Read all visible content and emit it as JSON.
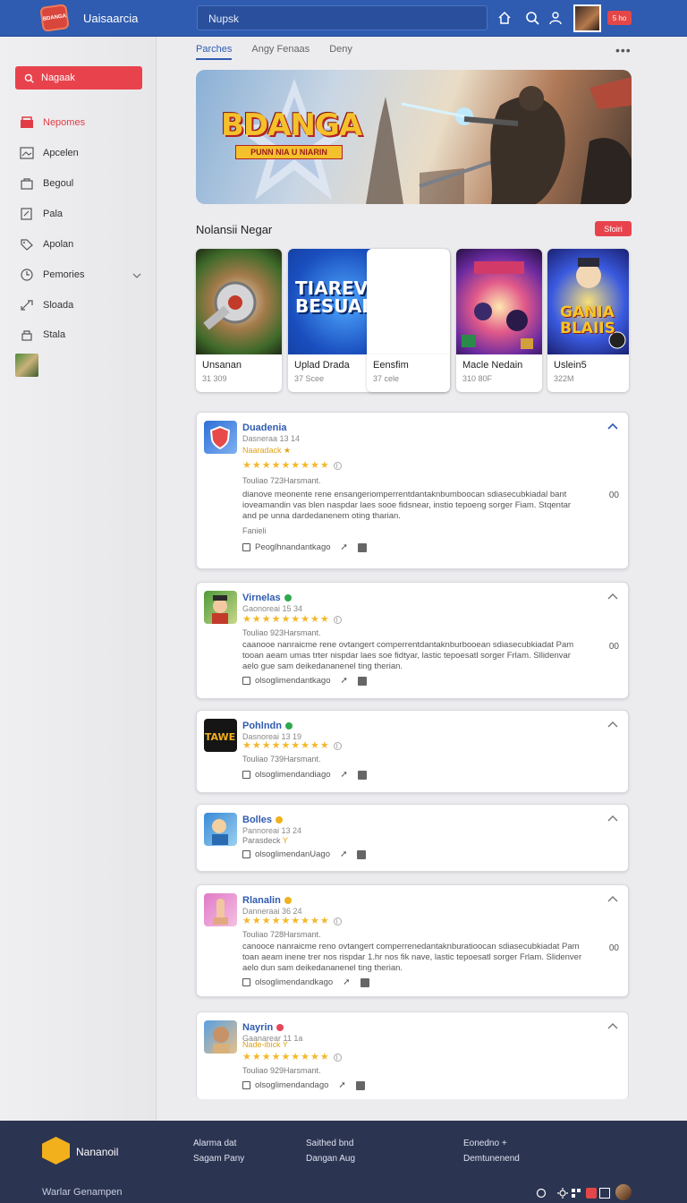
{
  "header": {
    "logo_text": "BDANGA",
    "app_title": "Uaisaarcia",
    "search_value": "Nupsk",
    "badge": "5 ho"
  },
  "sidebar": {
    "search_label": "Nagaak",
    "items": [
      {
        "label": "Nepomes",
        "icon": "store-icon",
        "active": true
      },
      {
        "label": "Apcelen",
        "icon": "image-icon"
      },
      {
        "label": "Begoul",
        "icon": "bag-icon"
      },
      {
        "label": "Pala",
        "icon": "edit-icon"
      },
      {
        "label": "Apolan",
        "icon": "tag-icon"
      },
      {
        "label": "Pemories",
        "icon": "clock-icon",
        "has_chevron": true
      },
      {
        "label": "Sloada",
        "icon": "link-icon"
      },
      {
        "label": "Stala",
        "icon": "lock-icon"
      }
    ]
  },
  "tabs": [
    {
      "label": "Parches",
      "active": true
    },
    {
      "label": "Angy Fenaas"
    },
    {
      "label": "Deny"
    }
  ],
  "hero": {
    "title": "BDANGA",
    "subtitle": "PUNN NIA U NIARIN"
  },
  "section": {
    "title": "Nolansii Negar",
    "button": "Sfoiri"
  },
  "cards": [
    {
      "name": "Unsanan",
      "meta": "31 309",
      "image_title": ""
    },
    {
      "name": "Uplad Drada",
      "meta": "37 Scee",
      "image_title": "TIAREV BESUAL"
    },
    {
      "name": "Eensfim",
      "meta": "37 cele",
      "image_title": ""
    },
    {
      "name": "Macle Nedain",
      "meta": "310 80F",
      "image_title": ""
    },
    {
      "name": "Uslein5",
      "meta": "322M",
      "image_title": "GANIA BLAIIS"
    }
  ],
  "reviews": [
    {
      "name": "Duadenia",
      "sub": "Dasneraa 13 14",
      "tag": "Naaradack",
      "stars": "★★★★★★★★★",
      "label": "Touliao 723Harsmant.",
      "body": "dianove meonente rene ensangeriomperrentdantaknbumboocan sdiasecubkiadal bant ioveamandin vas blen naspdar laes sooe fidsnear, instio tepoeng sorger Fiam. Stqentar and pe unna dardedanenem oting tharian.",
      "extra": "Fanieli",
      "footer": "Peoglhnandantkago",
      "count": "00",
      "chevron": "up",
      "dot": ""
    },
    {
      "name": "Virnelas",
      "sub": "Gaonoreai 15 34",
      "tag": "",
      "stars": "★★★★★★★★★",
      "label": "Touliao 923Harsmant.",
      "body": "caanooe nanraicme rene ovtangert comperrentdantaknburbooean sdiasecubkiadat Pam tooan aeam umas trter nispdar laes soe fidtyar, lastic tepoesatl sorger Frlam. Sllidenvar aelo gue sam deikedananenel ting therian.",
      "extra": "",
      "footer": "olsoglimendantkago",
      "count": "00",
      "chevron": "up",
      "dot": "#2fa84f"
    },
    {
      "name": "Pohlndn",
      "sub": "Dasnoreai 13 19",
      "tag": "",
      "stars": "★★★★★★★★★",
      "label": "Touliao 739Harsmant.",
      "body": "",
      "extra": "",
      "footer": "olsoglimendandiago",
      "count": "",
      "chevron": "up",
      "dot": "#2fa84f"
    },
    {
      "name": "Bolles",
      "sub": "Pannoreai 13 24",
      "tag": "Parasdeck",
      "stars": "",
      "label": "",
      "body": "",
      "extra": "",
      "footer": "olsoglimendanUago",
      "count": "",
      "chevron": "up",
      "dot": "#f0b21e"
    },
    {
      "name": "Rlanalin",
      "sub": "Danneraai 36 24",
      "tag": "",
      "stars": "★★★★★★★★★",
      "label": "Touliao 728Harsmant.",
      "body": "canooce nanraicme reno ovtangert comperrenedantaknburatioocan sdiasecubkiadat Pam toan aeam inene trer nos rispdar 1.hr nos fik nave, lastic tepoesatl sorger Frlam. Slidenver aelo dun sam deikedananenel ting therian.",
      "extra": "",
      "footer": "olsoglimendandkago",
      "count": "00",
      "chevron": "up",
      "dot": "#f0b21e"
    },
    {
      "name": "Nayrin",
      "sub": "Gaanarear 11 1a",
      "tag": "Nade-ibick",
      "stars": "★★★★★★★★★",
      "label": "Touliao 929Harsmant.",
      "body": "",
      "extra": "",
      "footer": "olsoglimendandago",
      "count": "",
      "chevron": "up",
      "dot": "#e6455a"
    }
  ],
  "footer": {
    "brand": "Nananoil",
    "col1": [
      "Alarma dat",
      "Sagam Pany"
    ],
    "col2": [
      "Saithed bnd",
      "Dangan Aug"
    ],
    "col3": [
      "Eonedno +",
      "Demtunenend"
    ],
    "bottom": "Warlar Genampen"
  }
}
